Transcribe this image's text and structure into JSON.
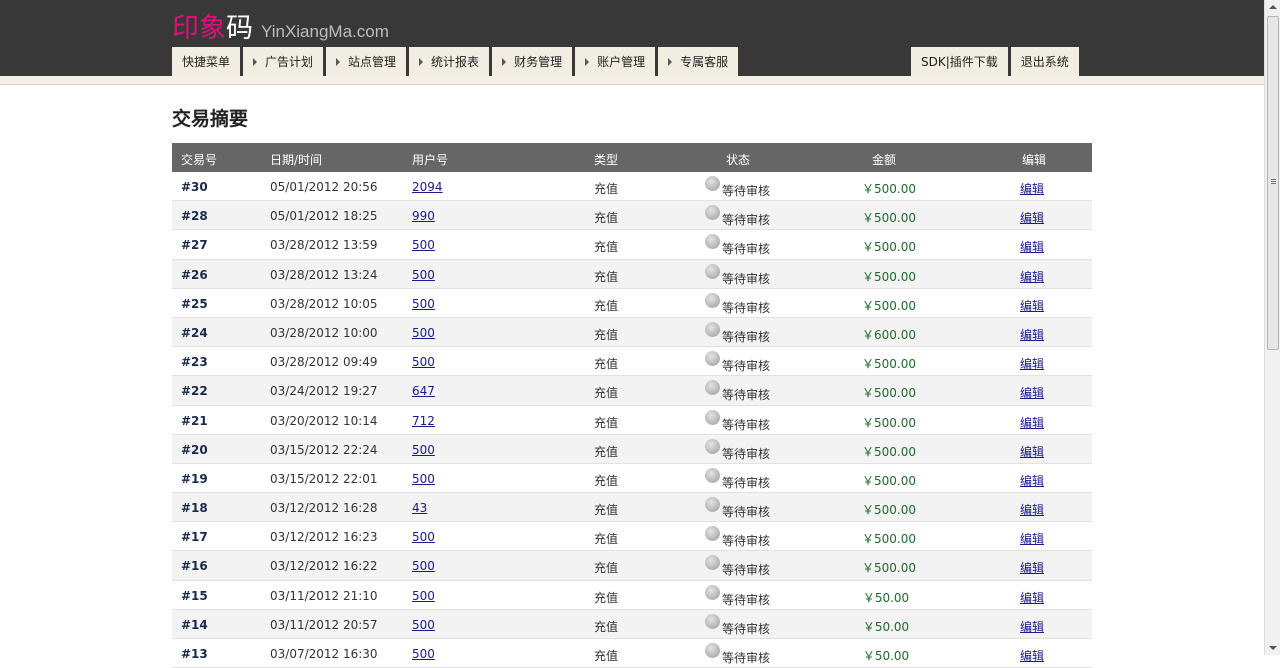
{
  "header": {
    "logo_cn_pink": "印象",
    "logo_cn_white": "码",
    "logo_domain": "YinXiangMa.com"
  },
  "nav": {
    "tabs": [
      {
        "label": "快捷菜单",
        "arrow": false
      },
      {
        "label": "广告计划",
        "arrow": true
      },
      {
        "label": "站点管理",
        "arrow": true
      },
      {
        "label": "统计报表",
        "arrow": true
      },
      {
        "label": "财务管理",
        "arrow": true
      },
      {
        "label": "账户管理",
        "arrow": true
      },
      {
        "label": "专属客服",
        "arrow": true
      }
    ],
    "right": [
      {
        "label": "SDK|插件下载"
      },
      {
        "label": "退出系统"
      }
    ]
  },
  "page_title": "交易摘要",
  "table": {
    "headers": {
      "id": "交易号",
      "date": "日期/时间",
      "user": "用户号",
      "type": "类型",
      "status": "状态",
      "amount": "金额",
      "edit": "编辑"
    },
    "rows": [
      {
        "id": "#30",
        "date": "05/01/2012 20:56",
        "user": "2094",
        "type": "充值",
        "status": "等待审核",
        "amount": "￥500.00",
        "edit": "编辑"
      },
      {
        "id": "#28",
        "date": "05/01/2012 18:25",
        "user": "990",
        "type": "充值",
        "status": "等待审核",
        "amount": "￥500.00",
        "edit": "编辑"
      },
      {
        "id": "#27",
        "date": "03/28/2012 13:59",
        "user": "500",
        "type": "充值",
        "status": "等待审核",
        "amount": "￥500.00",
        "edit": "编辑"
      },
      {
        "id": "#26",
        "date": "03/28/2012 13:24",
        "user": "500",
        "type": "充值",
        "status": "等待审核",
        "amount": "￥500.00",
        "edit": "编辑"
      },
      {
        "id": "#25",
        "date": "03/28/2012 10:05",
        "user": "500",
        "type": "充值",
        "status": "等待审核",
        "amount": "￥500.00",
        "edit": "编辑"
      },
      {
        "id": "#24",
        "date": "03/28/2012 10:00",
        "user": "500",
        "type": "充值",
        "status": "等待审核",
        "amount": "￥600.00",
        "edit": "编辑"
      },
      {
        "id": "#23",
        "date": "03/28/2012 09:49",
        "user": "500",
        "type": "充值",
        "status": "等待审核",
        "amount": "￥500.00",
        "edit": "编辑"
      },
      {
        "id": "#22",
        "date": "03/24/2012 19:27",
        "user": "647",
        "type": "充值",
        "status": "等待审核",
        "amount": "￥500.00",
        "edit": "编辑"
      },
      {
        "id": "#21",
        "date": "03/20/2012 10:14",
        "user": "712",
        "type": "充值",
        "status": "等待审核",
        "amount": "￥500.00",
        "edit": "编辑"
      },
      {
        "id": "#20",
        "date": "03/15/2012 22:24",
        "user": "500",
        "type": "充值",
        "status": "等待审核",
        "amount": "￥500.00",
        "edit": "编辑"
      },
      {
        "id": "#19",
        "date": "03/15/2012 22:01",
        "user": "500",
        "type": "充值",
        "status": "等待审核",
        "amount": "￥500.00",
        "edit": "编辑"
      },
      {
        "id": "#18",
        "date": "03/12/2012 16:28",
        "user": "43",
        "type": "充值",
        "status": "等待审核",
        "amount": "￥500.00",
        "edit": "编辑"
      },
      {
        "id": "#17",
        "date": "03/12/2012 16:23",
        "user": "500",
        "type": "充值",
        "status": "等待审核",
        "amount": "￥500.00",
        "edit": "编辑"
      },
      {
        "id": "#16",
        "date": "03/12/2012 16:22",
        "user": "500",
        "type": "充值",
        "status": "等待审核",
        "amount": "￥500.00",
        "edit": "编辑"
      },
      {
        "id": "#15",
        "date": "03/11/2012 21:10",
        "user": "500",
        "type": "充值",
        "status": "等待审核",
        "amount": "￥50.00",
        "edit": "编辑"
      },
      {
        "id": "#14",
        "date": "03/11/2012 20:57",
        "user": "500",
        "type": "充值",
        "status": "等待审核",
        "amount": "￥50.00",
        "edit": "编辑"
      },
      {
        "id": "#13",
        "date": "03/07/2012 16:30",
        "user": "500",
        "type": "充值",
        "status": "等待审核",
        "amount": "￥50.00",
        "edit": "编辑"
      }
    ]
  },
  "colors": {
    "topbar": "#383838",
    "logo_pink": "#e0107a",
    "table_header": "#666666",
    "amount_green": "#1f6a2a",
    "link_blue": "#1a1a8a"
  }
}
